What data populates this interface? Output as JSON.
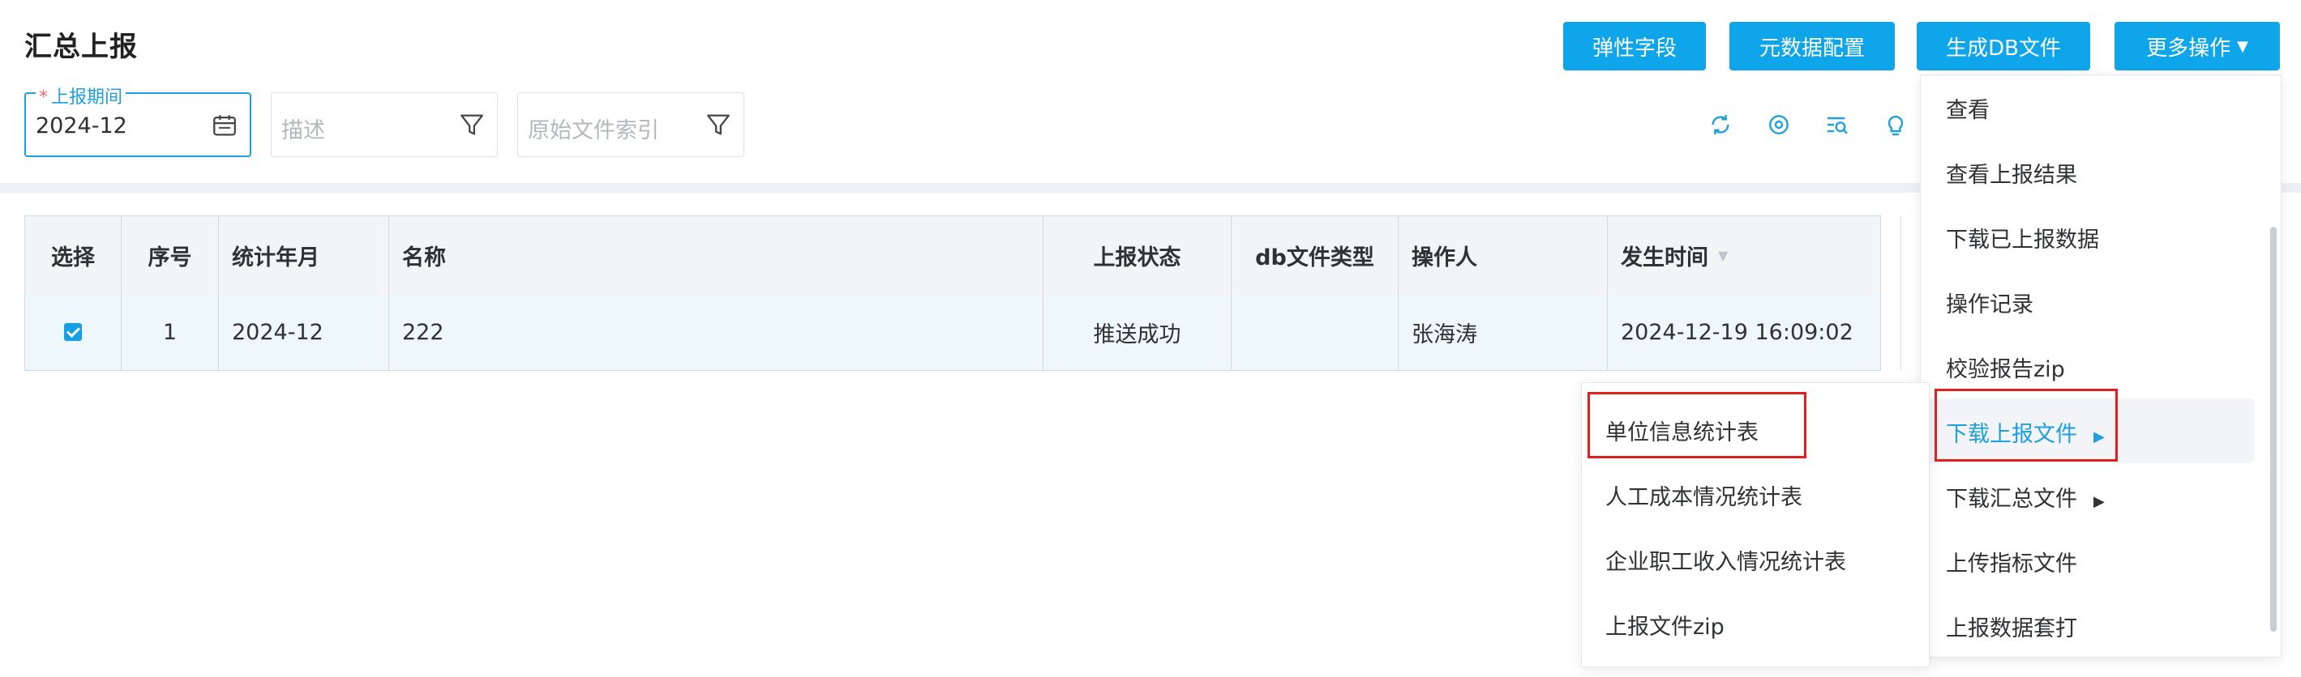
{
  "page": {
    "title": "汇总上报"
  },
  "header_buttons": {
    "flex_fields": "弹性字段",
    "metadata_config": "元数据配置",
    "generate_db": "生成DB文件",
    "more_actions": "更多操作"
  },
  "filters": {
    "period_label": "上报期间",
    "period_value": "2024-12",
    "description_placeholder": "描述",
    "file_index_placeholder": "原始文件索引"
  },
  "table": {
    "headers": [
      "选择",
      "序号",
      "统计年月",
      "名称",
      "上报状态",
      "db文件类型",
      "操作人",
      "发生时间"
    ],
    "rows": [
      {
        "index": "1",
        "year_month": "2024-12",
        "name": "222",
        "status": "推送成功",
        "db_type": "",
        "operator": "张海涛",
        "time": "2024-12-19 16:09:02",
        "selected": true
      }
    ]
  },
  "more_menu": {
    "items": [
      "查看",
      "查看上报结果",
      "下载已上报数据",
      "操作记录",
      "校验报告zip",
      "下载上报文件",
      "下载汇总文件",
      "上传指标文件",
      "上报数据套打"
    ],
    "highlighted": "下载上报文件"
  },
  "submenu": {
    "items": [
      "单位信息统计表",
      "人工成本情况统计表",
      "企业职工收入情况统计表",
      "上报文件zip"
    ]
  },
  "colors": {
    "accent": "#0ea5ea",
    "highlight": "#1e9fe0",
    "annotation": "#e02020"
  }
}
